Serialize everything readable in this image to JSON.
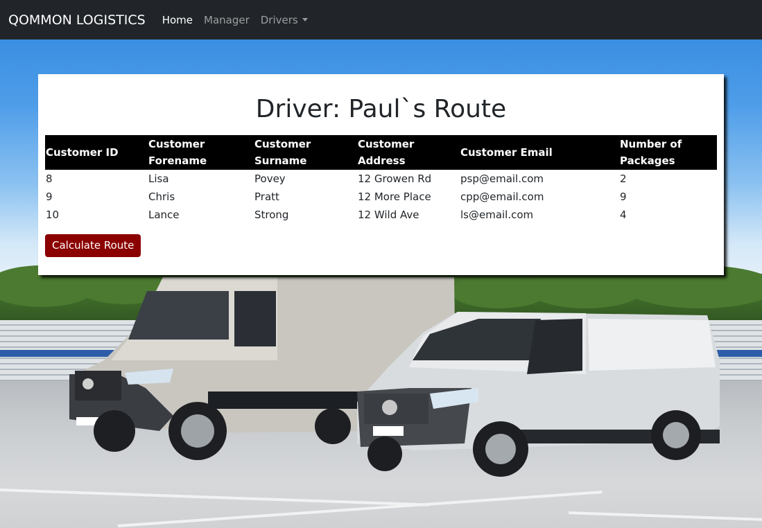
{
  "navbar": {
    "brand": "QOMMON LOGISTICS",
    "links": [
      {
        "label": "Home",
        "active": true
      },
      {
        "label": "Manager",
        "active": false
      },
      {
        "label": "Drivers",
        "active": false
      }
    ]
  },
  "card": {
    "title": "Driver: Paul`s Route",
    "table": {
      "headers": [
        "Customer ID",
        "Customer Forename",
        "Customer Surname",
        "Customer Address",
        "Customer Email",
        "Number of Packages"
      ],
      "rows": [
        [
          "8",
          "Lisa",
          "Povey",
          "12 Growen Rd",
          "psp@email.com",
          "2"
        ],
        [
          "9",
          "Chris",
          "Pratt",
          "12 More Place",
          "cpp@email.com",
          "9"
        ],
        [
          "10",
          "Lance",
          "Strong",
          "12 Wild Ave",
          "ls@email.com",
          "4"
        ]
      ]
    },
    "button_label": "Calculate Route"
  },
  "colors": {
    "navbar_bg": "#212529",
    "header_bg": "#000000",
    "button_bg": "#8b0000"
  }
}
